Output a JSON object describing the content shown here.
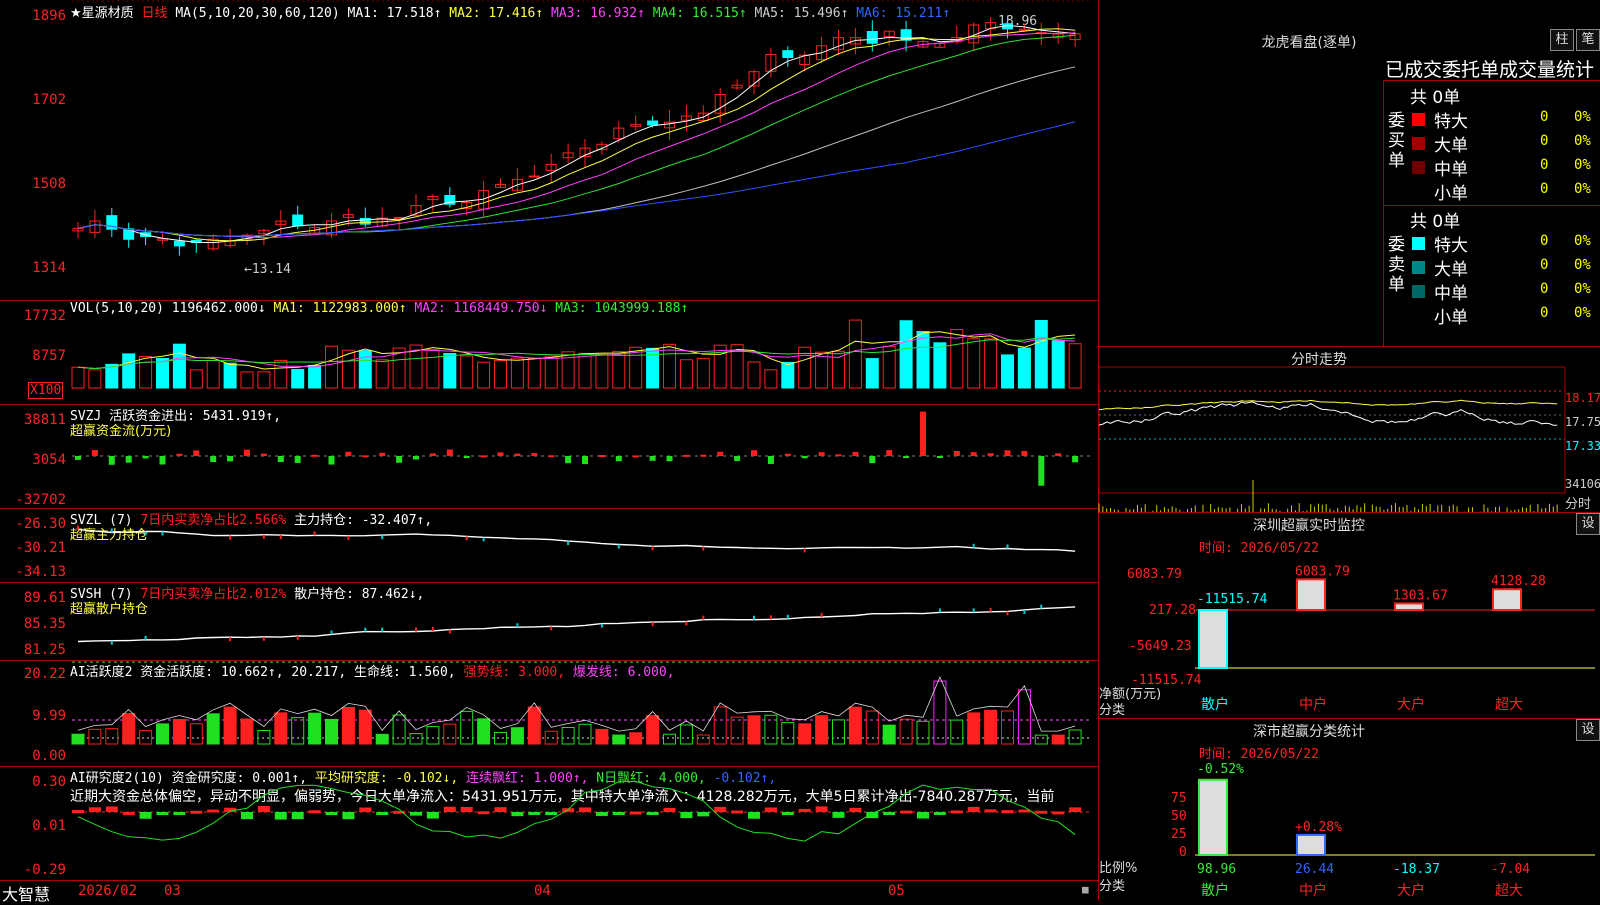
{
  "colors": {
    "up": "#ff2020",
    "down": "#00ffff",
    "ma1": "#ffffff",
    "ma2": "#ffff40",
    "ma3": "#ff40ff",
    "ma4": "#30e030",
    "ma5": "#c0c0c0",
    "ma6": "#3050ff",
    "axis": "#ff2020",
    "frame": "#a00000"
  },
  "main": {
    "title": "★星源材质",
    "period": "日线",
    "ma_label": "MA(5,10,20,30,60,120)",
    "ma1": "MA1: 17.518↑",
    "ma2": "MA2: 17.416↑",
    "ma3": "MA3: 16.932↑",
    "ma4": "MA4: 16.515↑",
    "ma5": "MA5: 15.496↑",
    "ma6": "MA6: 15.211↑",
    "y_ticks": [
      "1896",
      "1702",
      "1508",
      "1314"
    ],
    "high_label": "18.96",
    "low_label": "←13.14"
  },
  "vol": {
    "label": "VOL(5,10,20)",
    "val": "1196462.000↓",
    "ma1": "MA1: 1122983.000↑",
    "ma2": "MA2: 1168449.750↓",
    "ma3": "MA3: 1043999.188↑",
    "y_ticks": [
      "17732",
      "8757"
    ],
    "unit": "X100"
  },
  "svzj": {
    "label": "SVZJ  活跃资金进出: 5431.919↑,",
    "sub": "超赢资金流(万元)",
    "y_ticks": [
      "38811",
      "3054",
      "-32702"
    ]
  },
  "svzl": {
    "label": "SVZL (7)",
    "pct": "7日内买卖净占比2.566%",
    "hold": "主力持仓: -32.407↑,",
    "sub": "超赢主力持仓",
    "y_ticks": [
      "-26.30",
      "-30.21",
      "-34.13"
    ]
  },
  "svsh": {
    "label": "SVSH (7)",
    "pct": "7日内买卖净占比2.012%",
    "hold": "散户持仓: 87.462↓,",
    "sub": "超赢散户持仓",
    "y_ticks": [
      "89.61",
      "85.35",
      "81.25"
    ]
  },
  "ai1": {
    "label": "AI活跃度2 资金活跃度: 10.662↑, 20.217, 生命线: 1.560,",
    "strong": "强势线: 3.000,",
    "burst": "爆发线: 6.000,",
    "y_ticks": [
      "20.22",
      "9.99",
      "0.00"
    ]
  },
  "ai2": {
    "label": "AI研究度2(10) 资金研究度: 0.001↑,",
    "avg": "平均研究度: -0.102↓,",
    "lianxu": "连续飘红: 1.000↑,",
    "nday": "N日飘红: 4.000,",
    "last": "-0.102↑,",
    "text": "近期大资金总体偏空，异动不明显，偏弱势，今日大单净流入：5431.951万元，其中特大单净流入：4128.282万元，大单5日累计净出-7840.287万元，当前",
    "y_ticks": [
      "0.30",
      "0.01",
      "-0.29"
    ]
  },
  "bottom": {
    "brand": "大智慧",
    "date": "2026/02",
    "months": [
      "03",
      "04",
      "05"
    ]
  },
  "lhb": {
    "title": "龙虎看盘(逐单)",
    "btn_zhu": "柱",
    "btn_bi": "笔",
    "header": "已成交委托单成交量统计",
    "buy_side": "委买单",
    "sell_side": "委卖单",
    "buy_total": "共 0单",
    "sell_total": "共 0单",
    "rows": [
      "特大",
      "大单",
      "中单",
      "小单"
    ],
    "vals": [
      "0",
      "0",
      "0",
      "0"
    ],
    "pcts": [
      "0%",
      "0%",
      "0%",
      "0%"
    ]
  },
  "fenshi": {
    "title": "分时走势",
    "y_ticks": [
      "18.17",
      "17.75",
      "17.33"
    ],
    "vol_tick": "34106",
    "bottom_label": "分时"
  },
  "sz_monitor": {
    "title": "深圳超赢实时监控",
    "btn": "设",
    "time": "时间: 2026/05/22",
    "y_ticks": [
      "6083.79",
      "217.28",
      "-5649.23",
      "-11515.74"
    ],
    "values": [
      "-11515.74",
      "6083.79",
      "1303.67",
      "4128.28"
    ],
    "cats": [
      "散户",
      "中户",
      "大户",
      "超大"
    ],
    "ylabel": "净额(万元)",
    "xlabel": "分类"
  },
  "sz_class": {
    "title": "深市超赢分类统计",
    "btn": "设",
    "time": "时间: 2026/05/22",
    "y_ticks": [
      "75",
      "50",
      "25",
      "0"
    ],
    "bar_labels": [
      "-0.52%",
      "+0.28%"
    ],
    "values": [
      "98.96",
      "26.44",
      "-18.37",
      "-7.04"
    ],
    "cats": [
      "散户",
      "中户",
      "大户",
      "超大"
    ],
    "ylabel": "比例%",
    "xlabel": "分类"
  }
}
